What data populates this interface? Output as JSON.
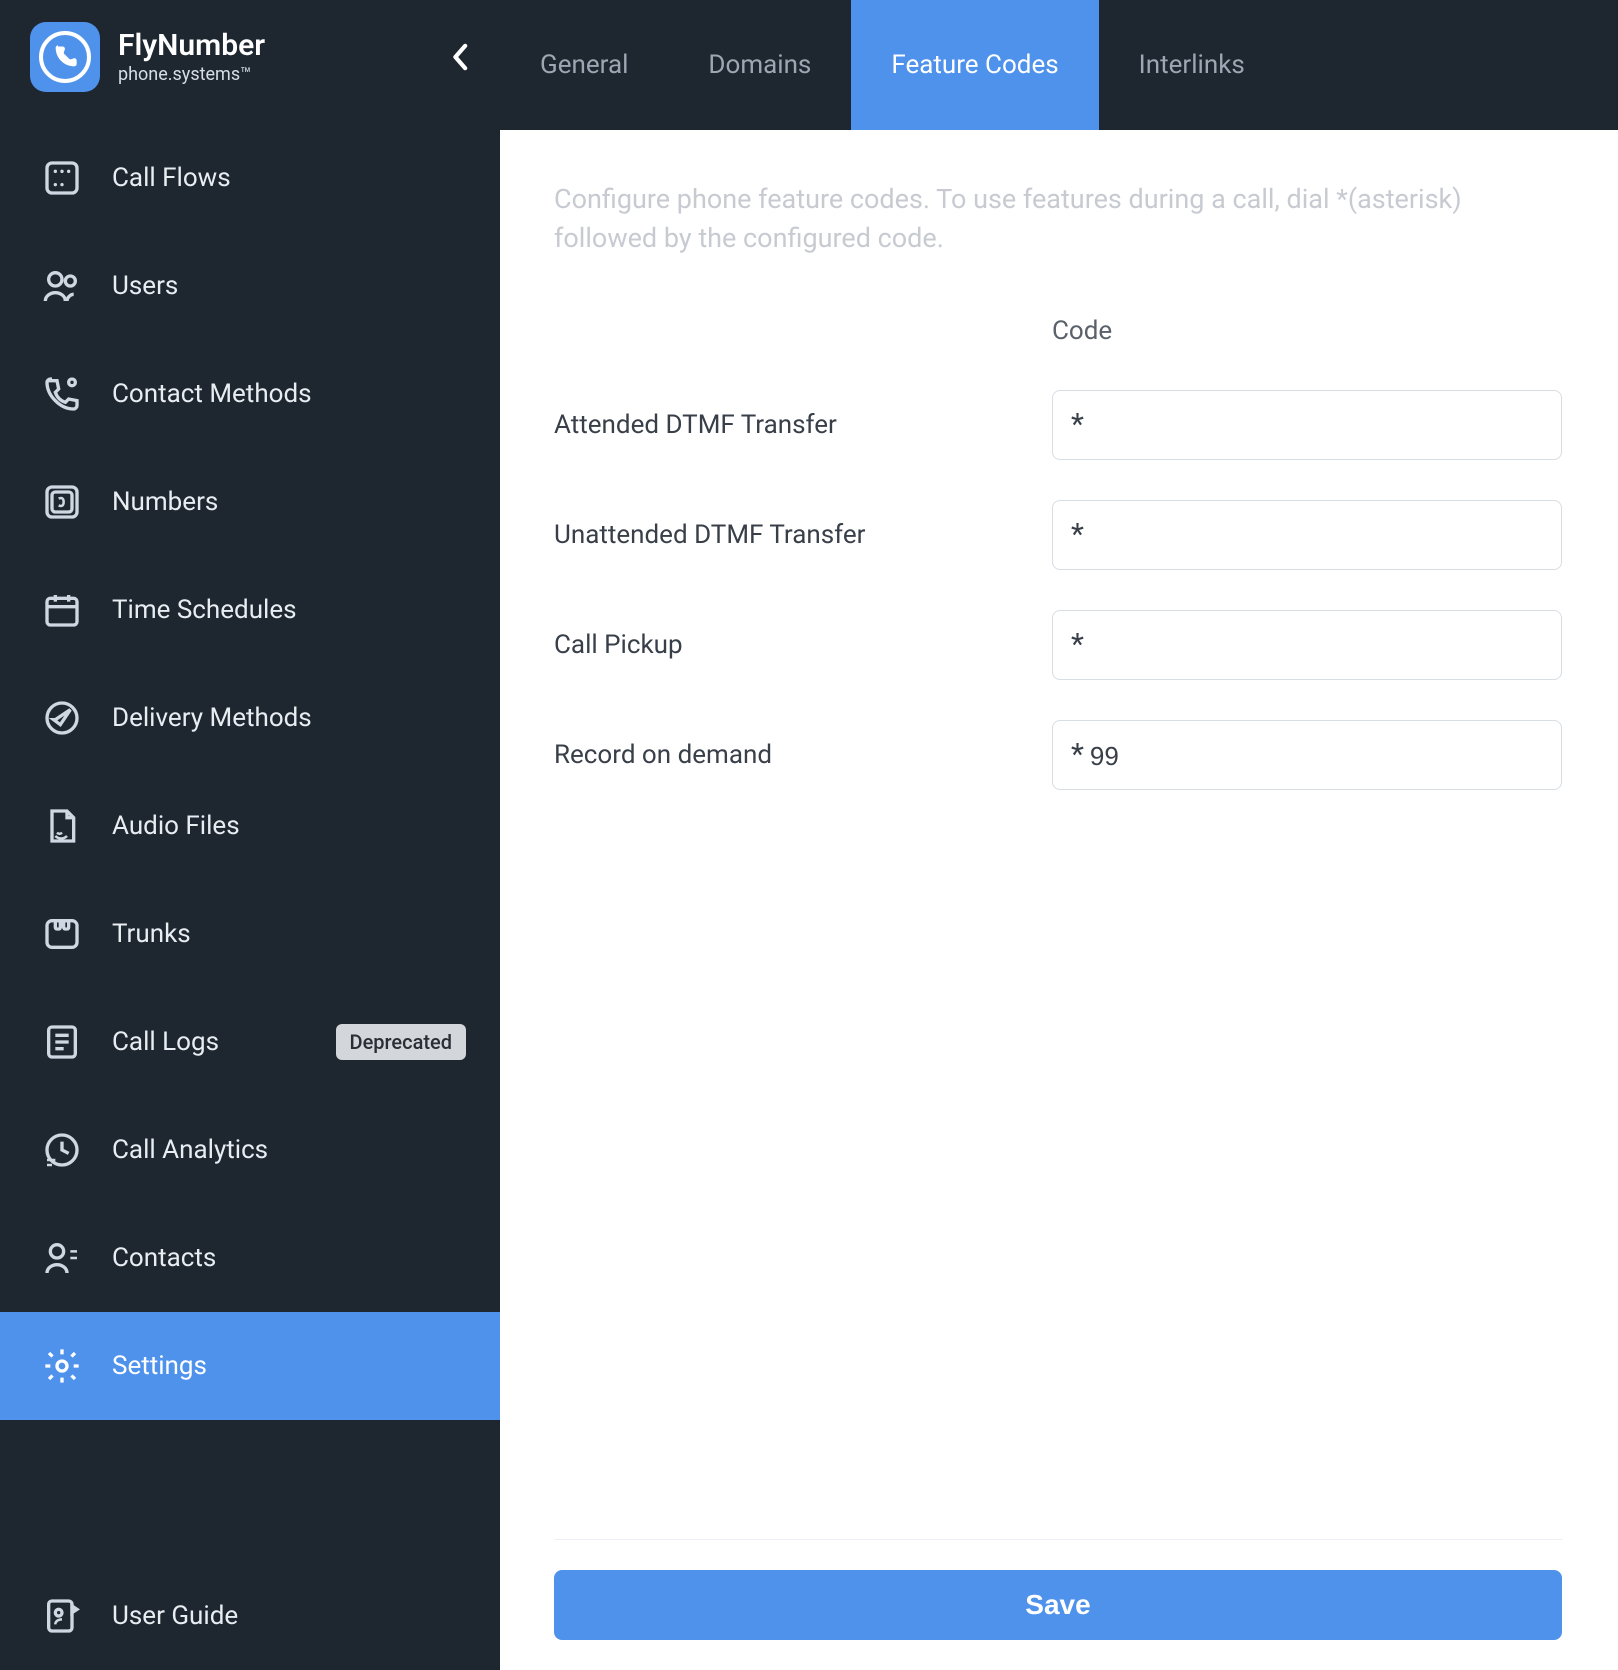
{
  "brand": {
    "title": "FlyNumber",
    "subtitle": "phone.systems™"
  },
  "sidebar": {
    "items": [
      {
        "label": "Call Flows",
        "icon": "flow-icon"
      },
      {
        "label": "Users",
        "icon": "users-icon"
      },
      {
        "label": "Contact Methods",
        "icon": "contact-methods-icon"
      },
      {
        "label": "Numbers",
        "icon": "numbers-icon"
      },
      {
        "label": "Time Schedules",
        "icon": "calendar-icon"
      },
      {
        "label": "Delivery Methods",
        "icon": "delivery-icon"
      },
      {
        "label": "Audio Files",
        "icon": "audio-file-icon"
      },
      {
        "label": "Trunks",
        "icon": "trunks-icon"
      },
      {
        "label": "Call Logs",
        "icon": "logs-icon",
        "badge": "Deprecated"
      },
      {
        "label": "Call Analytics",
        "icon": "analytics-icon"
      },
      {
        "label": "Contacts",
        "icon": "contacts-icon"
      },
      {
        "label": "Settings",
        "icon": "gear-icon",
        "active": true
      }
    ],
    "footer": {
      "label": "User Guide",
      "icon": "guide-icon"
    }
  },
  "tabs": [
    {
      "label": "General"
    },
    {
      "label": "Domains"
    },
    {
      "label": "Feature Codes",
      "active": true
    },
    {
      "label": "Interlinks"
    }
  ],
  "page": {
    "description": "Configure phone feature codes. To use features during a call, dial *(asterisk) followed by the configured code.",
    "code_header": "Code",
    "fields": [
      {
        "label": "Attended DTMF Transfer",
        "prefix": "*",
        "value": ""
      },
      {
        "label": "Unattended DTMF Transfer",
        "prefix": "*",
        "value": ""
      },
      {
        "label": "Call Pickup",
        "prefix": "*",
        "value": ""
      },
      {
        "label": "Record on demand",
        "prefix": "*",
        "value": "99"
      }
    ],
    "save_label": "Save"
  }
}
